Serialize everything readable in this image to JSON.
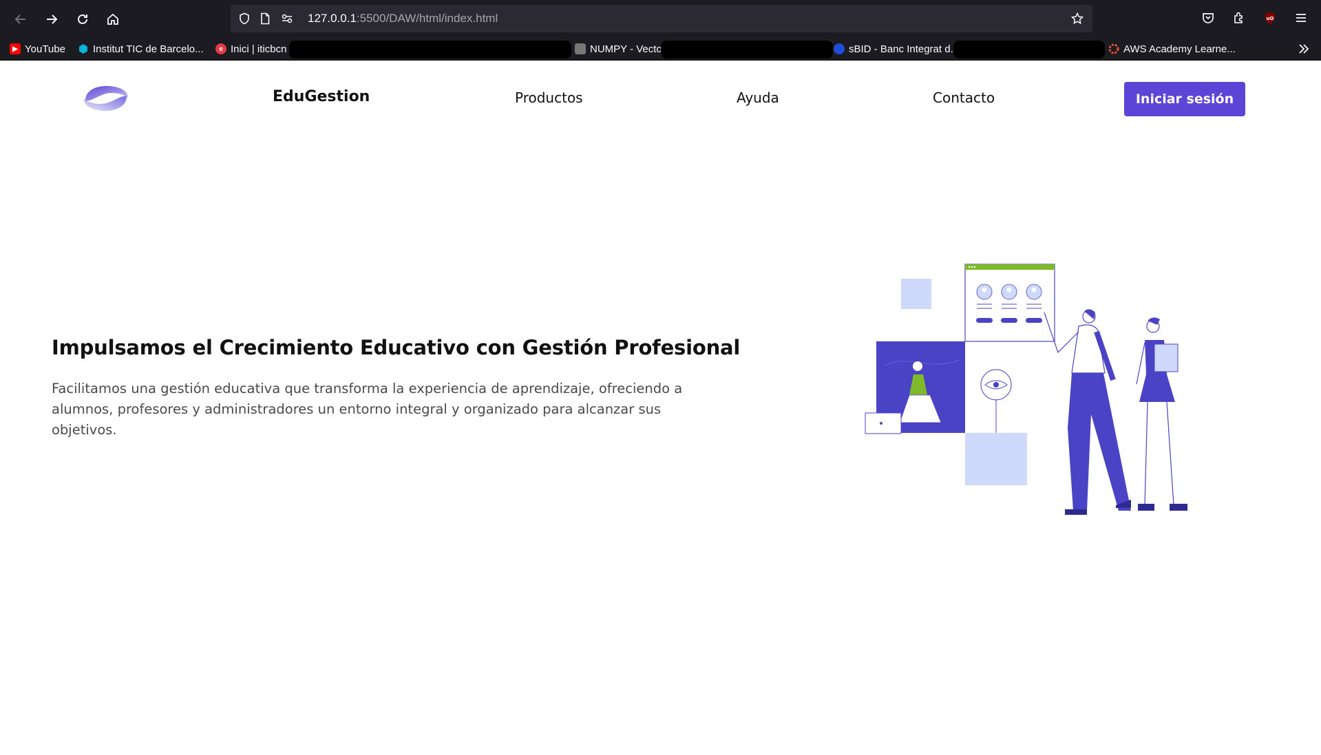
{
  "browser": {
    "url_host": "127.0.0.1",
    "url_path": ":5500/DAW/html/index.html",
    "bookmarks": [
      {
        "label": "YouTube",
        "icon": "youtube-icon",
        "color": "#ff0000"
      },
      {
        "label": "Institut TIC de Barcelo...",
        "icon": "institut-tic-icon",
        "color": "#00b4d8"
      },
      {
        "label": "Inici | iticbcn",
        "icon": "iticbcn-icon",
        "color": "#e63946"
      },
      {
        "label": "NUMPY - Vectors y ...",
        "icon": "numpy-icon",
        "color": "#888888"
      },
      {
        "label": "sBID - Banc Integrat d...",
        "icon": "sbid-icon",
        "color": "#1d4ed8"
      },
      {
        "label": "AWS Academy Learne...",
        "icon": "aws-icon",
        "color": "#e4572e"
      }
    ]
  },
  "header": {
    "brand": "EduGestion",
    "nav": [
      "Productos",
      "Ayuda",
      "Contacto"
    ],
    "login_label": "Iniciar sesión"
  },
  "hero": {
    "title": "Impulsamos el Crecimiento Educativo con Gestión Profesional",
    "text": "Facilitamos una gestión educativa que transforma la experiencia de aprendizaje, ofreciendo a alumnos, profesores y administradores un entorno integral y organizado para alcanzar sus objetivos."
  },
  "colors": {
    "accent": "#5b44d6",
    "illustration_primary": "#4b43c6",
    "illustration_light": "#cfd9fb",
    "illustration_green": "#7fba2a"
  }
}
